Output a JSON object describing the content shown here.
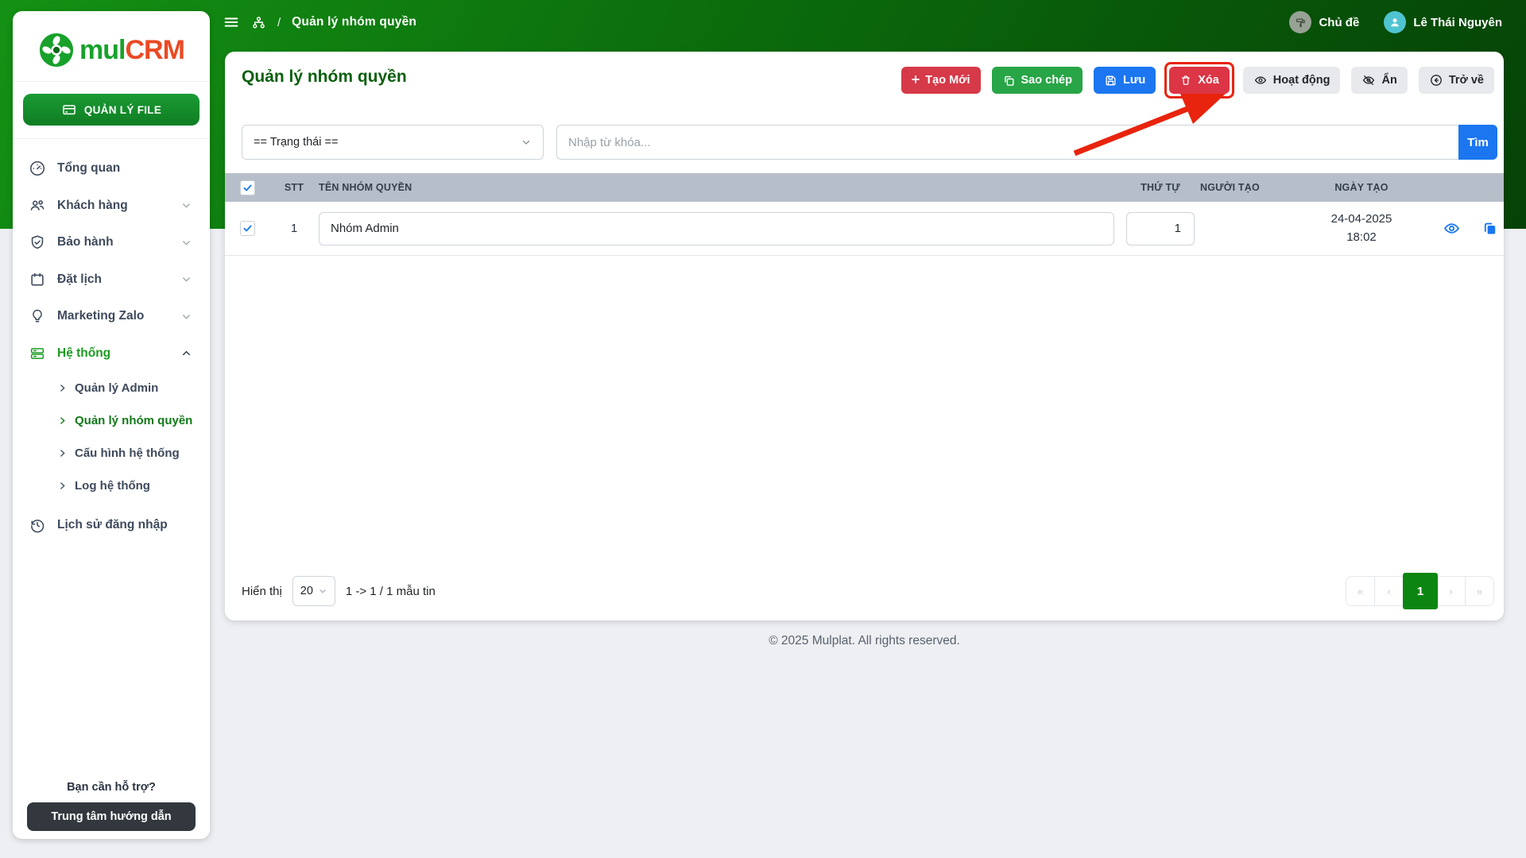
{
  "topbar": {
    "breadcrumb": {
      "separator": "/",
      "current": "Quản lý nhóm quyền"
    },
    "theme_label": "Chủ đề",
    "user_name": "Lê Thái Nguyên"
  },
  "sidebar": {
    "logo": {
      "part1": "mul",
      "part2": "CRM"
    },
    "file_button": "QUẢN LÝ FILE",
    "items": [
      {
        "label": "Tổng quan"
      },
      {
        "label": "Khách hàng"
      },
      {
        "label": "Bảo hành"
      },
      {
        "label": "Đặt lịch"
      },
      {
        "label": "Marketing Zalo"
      },
      {
        "label": "Hệ thống"
      },
      {
        "label": "Lịch sử đăng nhập"
      }
    ],
    "system_subitems": [
      {
        "label": "Quản lý Admin"
      },
      {
        "label": "Quản lý nhóm quyền"
      },
      {
        "label": "Cấu hình hệ thống"
      },
      {
        "label": "Log hệ thống"
      }
    ],
    "help_text": "Bạn cần hỗ trợ?",
    "help_button": "Trung tâm hướng dẫn"
  },
  "page": {
    "title": "Quản lý nhóm quyền",
    "actions": {
      "create_plus": "+",
      "create": "Tạo Mới",
      "copy": "Sao chép",
      "save": "Lưu",
      "delete": "Xóa",
      "activate": "Hoạt động",
      "hide": "Ẩn",
      "back": "Trở về"
    },
    "filters": {
      "status": "== Trạng thái ==",
      "keyword_placeholder": "Nhập từ khóa...",
      "search": "Tìm"
    },
    "table": {
      "headers": {
        "stt": "STT",
        "name": "TÊN NHÓM QUYỀN",
        "order": "THỨ TỰ",
        "creator": "NGƯỜI TẠO",
        "created": "NGÀY TẠO"
      },
      "rows": [
        {
          "stt": "1",
          "name": "Nhóm Admin",
          "order": "1",
          "creator": "",
          "created_date": "24-04-2025",
          "created_time": "18:02"
        }
      ]
    },
    "pagination": {
      "show_label": "Hiển thị",
      "page_size": "20",
      "info": "1 -> 1 / 1 mẫu tin",
      "first": "«",
      "prev": "‹",
      "current": "1",
      "next": "›",
      "last": "»"
    }
  },
  "footer": {
    "copyright": "© 2025 Mulplat. All rights reserved."
  },
  "icons": {
    "topbar": [
      "menu-icon",
      "sitemap-icon",
      "paint-roller-icon",
      "user-avatar-icon"
    ],
    "sidebar": [
      "dashboard-icon",
      "users-icon",
      "shield-check-icon",
      "calendar-icon",
      "lightbulb-icon",
      "server-icon",
      "history-icon"
    ],
    "buttons": [
      "plus-icon",
      "copy-icon",
      "save-icon",
      "trash-icon",
      "eye-icon",
      "eye-off-icon",
      "back-circle-icon"
    ]
  },
  "colors": {
    "header_green_dark": "#054206",
    "header_green_light": "#149114",
    "brand_green": "#18a12b",
    "brand_orange": "#ea4a24",
    "primary_blue": "#1b76f0",
    "success_green": "#28a546",
    "danger_red": "#dc3545",
    "active_page_green": "#0c8611",
    "table_header_gray": "#b6bec9",
    "annotation_red": "#e8240e"
  }
}
